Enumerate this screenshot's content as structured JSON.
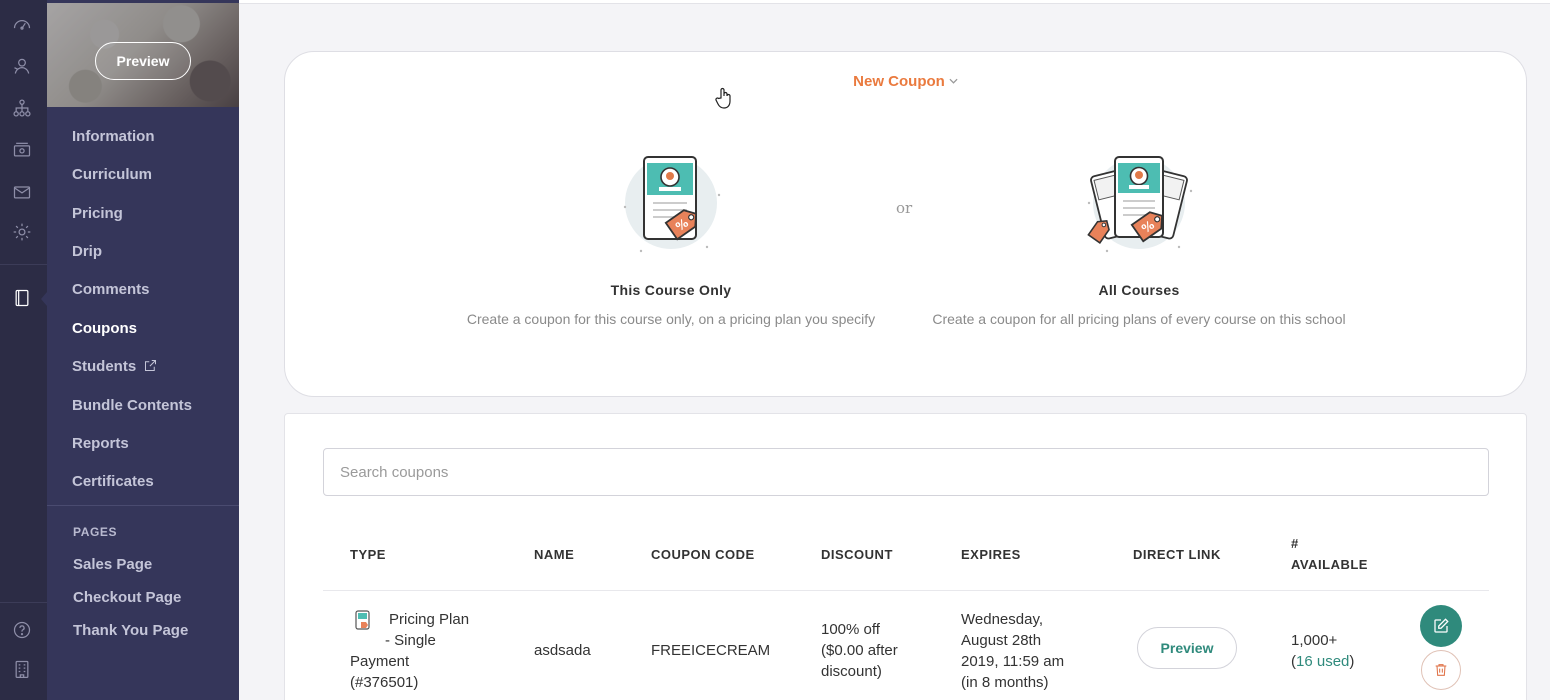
{
  "sidebar": {
    "preview_label": "Preview",
    "items": [
      {
        "label": "Information"
      },
      {
        "label": "Curriculum"
      },
      {
        "label": "Pricing"
      },
      {
        "label": "Drip"
      },
      {
        "label": "Comments"
      },
      {
        "label": "Coupons",
        "active": true
      },
      {
        "label": "Students"
      },
      {
        "label": "Bundle Contents"
      },
      {
        "label": "Reports"
      },
      {
        "label": "Certificates"
      }
    ],
    "pages_heading": "PAGES",
    "pages": [
      {
        "label": "Sales Page"
      },
      {
        "label": "Checkout Page"
      },
      {
        "label": "Thank You Page"
      }
    ]
  },
  "new_coupon": {
    "label": "New Coupon",
    "or_text": "or",
    "options": [
      {
        "title": "This Course Only",
        "description": "Create a coupon for this course only, on a pricing plan you specify"
      },
      {
        "title": "All Courses",
        "description": "Create a coupon for all pricing plans of every course on this school"
      }
    ]
  },
  "coupons": {
    "search_placeholder": "Search coupons",
    "columns": {
      "type": "TYPE",
      "name": "NAME",
      "code": "COUPON CODE",
      "discount": "DISCOUNT",
      "expires": "EXPIRES",
      "direct_link": "DIRECT LINK",
      "available_line1": "#",
      "available_line2": "AVAILABLE"
    },
    "rows": [
      {
        "type_line1": "Pricing Plan",
        "type_line2": "- Single",
        "type_line3": "Payment",
        "type_line4": "(#376501)",
        "name": "asdsada",
        "code": "FREEICECREAM",
        "discount_line1": "100% off",
        "discount_line2": "($0.00 after",
        "discount_line3": "discount)",
        "expires_line1": "Wednesday,",
        "expires_line2": "August 28th",
        "expires_line3": "2019, 11:59 am",
        "expires_line4": "(in 8 months)",
        "link_label": "Preview",
        "available": "1,000+",
        "used_prefix": "(",
        "used": "16 used",
        "used_suffix": ")"
      }
    ]
  },
  "colors": {
    "accent_orange": "#ea7a3e",
    "accent_teal": "#2f8a7c",
    "sidebar_bg": "#35365a",
    "rail_bg": "#2c2c45"
  }
}
